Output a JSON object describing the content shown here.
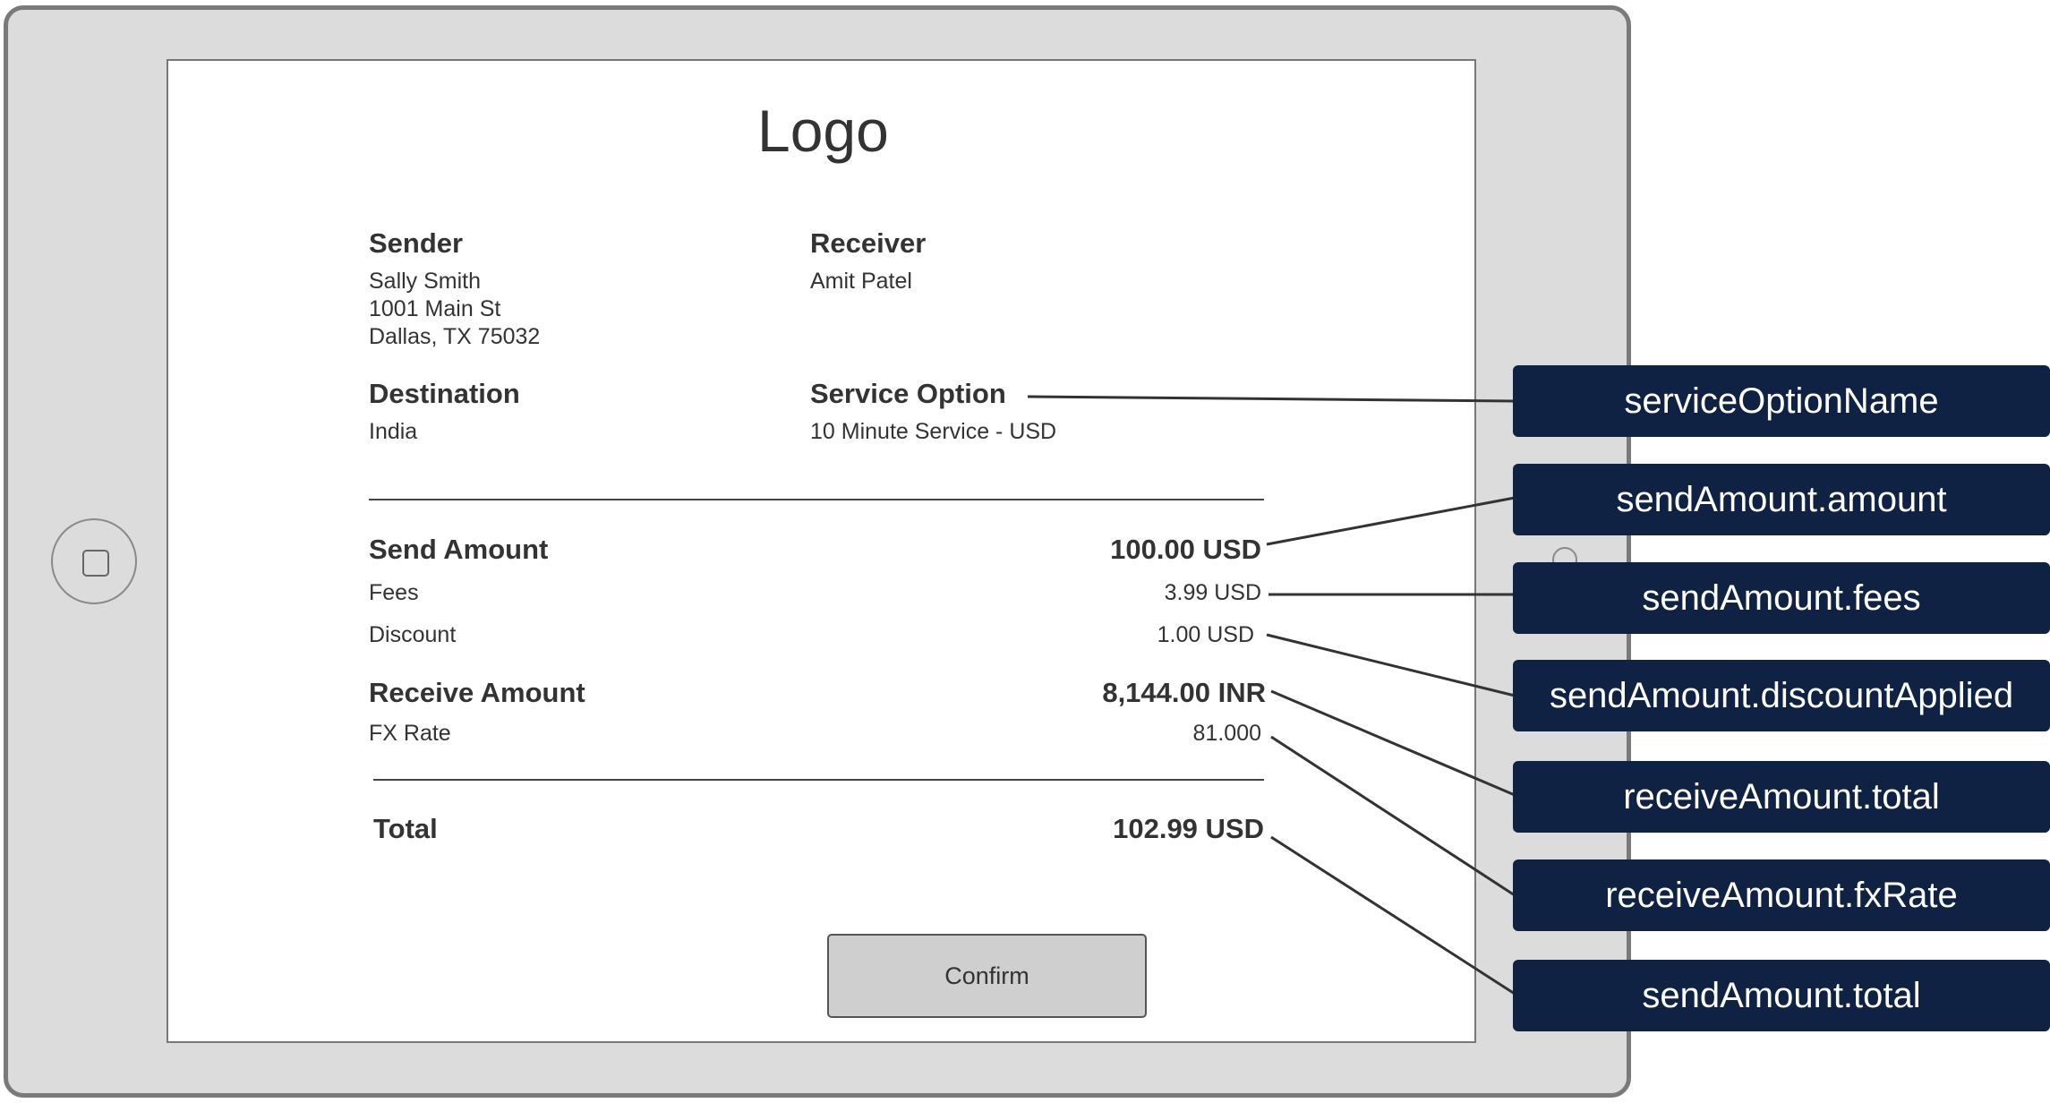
{
  "screen": {
    "logo": "Logo",
    "sender": {
      "label": "Sender",
      "name": "Sally Smith",
      "street": "1001 Main St",
      "city": "Dallas, TX 75032"
    },
    "receiver": {
      "label": "Receiver",
      "name": "Amit Patel"
    },
    "destination": {
      "label": "Destination",
      "value": "India"
    },
    "service_option": {
      "label": "Service Option",
      "value": "10 Minute Service - USD"
    },
    "send_amount": {
      "label": "Send Amount",
      "value": "100.00 USD"
    },
    "fees": {
      "label": "Fees",
      "value": "3.99 USD"
    },
    "discount": {
      "label": "Discount",
      "value": "1.00 USD"
    },
    "receive_amount": {
      "label": "Receive Amount",
      "value": "8,144.00 INR"
    },
    "fx_rate": {
      "label": "FX Rate",
      "value": "81.000"
    },
    "total": {
      "label": "Total",
      "value": "102.99 USD"
    },
    "confirm_label": "Confirm"
  },
  "annotations": [
    "serviceOptionName",
    "sendAmount.amount",
    "sendAmount.fees",
    "sendAmount.discountApplied",
    "receiveAmount.total",
    "receiveAmount.fxRate",
    "sendAmount.total"
  ],
  "colors": {
    "annotation_bg": "#0f2244",
    "tablet_frame": "#dcdcdc",
    "button_bg": "#cfcfcf"
  }
}
